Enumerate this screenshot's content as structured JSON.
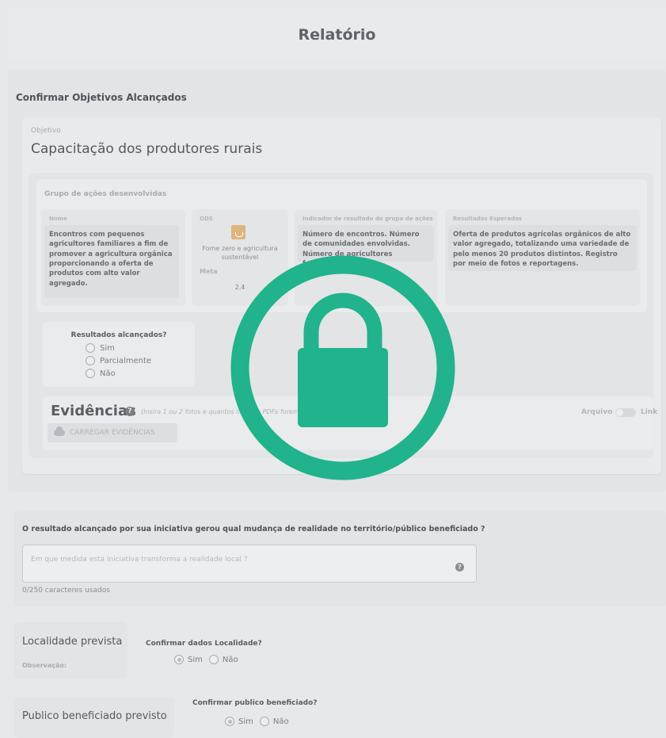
{
  "header": {
    "title": "Relatório"
  },
  "objectives": {
    "section_title": "Confirmar Objetivos Alcançados",
    "objective_label": "Objetivo",
    "objective_title": "Capacitação dos produtores rurais",
    "group_label": "Grupo de ações desenvolvidas",
    "columns": {
      "nome": {
        "label": "Nome",
        "text": "Encontros com pequenos agricultores familiares a fim de promover a agricultura orgânica proporcionando a oferta de produtos com alto valor agregado."
      },
      "ods": {
        "label": "ODS",
        "icon": "sdg-icon",
        "text": "Fome zero e agricultura sustentável",
        "meta_label": "Meta",
        "meta_value": "2.4"
      },
      "indicador": {
        "label": "Indicador de resultado do grupo de ações",
        "text": "Número de encontros. Número de comunidades envolvidas. Número de agricultores familiares"
      },
      "resultados": {
        "label": "Resultados Esperados",
        "text": "Oferta de produtos agrícolas orgânicos de alto valor agregado, totalizando uma variedade de pelo menos 20 produtos distintos. Registro por meio de fotos e reportagens."
      }
    },
    "results": {
      "title": "Resultados alcançados?",
      "options": [
        "Sim",
        "Parcialmente",
        "Não"
      ]
    },
    "evidence": {
      "title": "Evidências",
      "hint": "(Insira 1 ou 2 fotos e quantos links ou PDFs forem ne",
      "toggle_left": "Arquivo",
      "toggle_right": "Link",
      "upload_label": "CARREGAR EVIDÊNCIAS"
    }
  },
  "result_change": {
    "question": "O resultado alcançado por sua iniciativa gerou qual mudança de realidade no território/público beneficiado ?",
    "placeholder": "Em que medida está iniciativa transforma a realidade local ?",
    "counter": "0/250 caracteres usados"
  },
  "locality": {
    "title": "Localidade prevista",
    "observation_label": "Observação:",
    "confirm_title": "Confirmar dados Localidade?",
    "options": [
      "Sim",
      "Não"
    ],
    "selected": "Sim"
  },
  "public": {
    "title": "Publico beneficiado previsto",
    "confirm_title": "Confirmar publico beneficiado?",
    "options": [
      "Sim",
      "Não"
    ],
    "selected": "Sim"
  },
  "overlay": {
    "icon": "lock-icon",
    "color": "#21b38b"
  },
  "colors": {
    "background": "#e6e8ea",
    "accent": "#21b38b",
    "ods_tile": "#dfb57e"
  }
}
